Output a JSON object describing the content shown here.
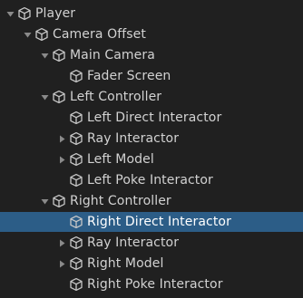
{
  "hierarchy": {
    "items": [
      {
        "label": "Player",
        "expanded": true,
        "has_children": true,
        "depth": 0
      },
      {
        "label": "Camera Offset",
        "expanded": true,
        "has_children": true,
        "depth": 1
      },
      {
        "label": "Main Camera",
        "expanded": true,
        "has_children": true,
        "depth": 2
      },
      {
        "label": "Fader Screen",
        "expanded": false,
        "has_children": false,
        "depth": 3
      },
      {
        "label": "Left Controller",
        "expanded": true,
        "has_children": true,
        "depth": 2
      },
      {
        "label": "Left Direct Interactor",
        "expanded": false,
        "has_children": false,
        "depth": 3
      },
      {
        "label": "Ray Interactor",
        "expanded": false,
        "has_children": true,
        "depth": 3
      },
      {
        "label": "Left Model",
        "expanded": false,
        "has_children": true,
        "depth": 3
      },
      {
        "label": "Left Poke Interactor",
        "expanded": false,
        "has_children": false,
        "depth": 3
      },
      {
        "label": "Right Controller",
        "expanded": true,
        "has_children": true,
        "depth": 2
      },
      {
        "label": "Right Direct Interactor",
        "expanded": false,
        "has_children": false,
        "depth": 3,
        "selected": true
      },
      {
        "label": "Ray Interactor",
        "expanded": false,
        "has_children": true,
        "depth": 3
      },
      {
        "label": "Right Model",
        "expanded": false,
        "has_children": true,
        "depth": 3
      },
      {
        "label": "Right Poke Interactor",
        "expanded": false,
        "has_children": false,
        "depth": 3
      }
    ],
    "icon": "gameobject-cube-icon",
    "colors": {
      "background": "#202020",
      "text": "#d2d2d2",
      "selection": "#2c5d87",
      "arrow": "#8a8a8a",
      "icon": "#c8c8c8"
    }
  }
}
